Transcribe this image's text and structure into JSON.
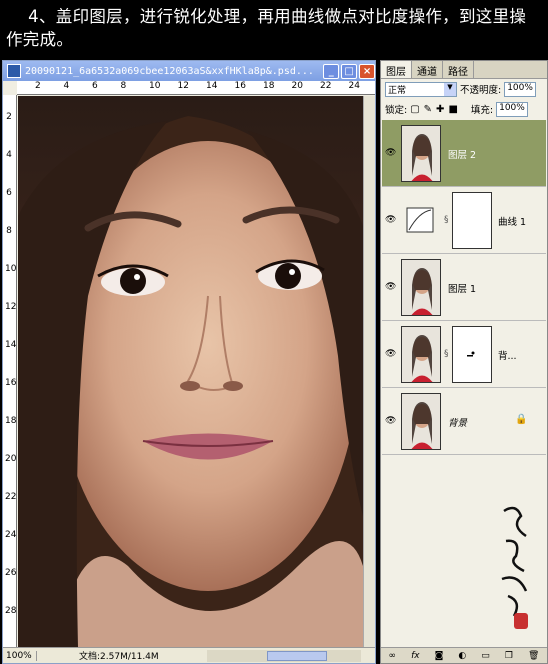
{
  "caption": {
    "line1": "    4、盖印图层，进行锐化处理，再用曲线做点对比度操作，到这里操",
    "line2": "作完成。"
  },
  "document": {
    "title": "20090121_6a6532a069cbee12063aS&xxfHKla8p&.psd...",
    "ruler_top_ticks": [
      "2",
      "4",
      "6",
      "8",
      "10",
      "12",
      "14",
      "16",
      "18",
      "20",
      "22",
      "24"
    ],
    "ruler_left_ticks": [
      "2",
      "4",
      "6",
      "8",
      "10",
      "12",
      "14",
      "16",
      "18",
      "20",
      "22",
      "24",
      "26",
      "28"
    ],
    "zoom": "100%",
    "doc_info": "文档:2.57M/11.4M",
    "min_icon": "minimize-icon",
    "max_icon": "maximize-icon",
    "close_icon": "close-icon"
  },
  "layers_panel": {
    "tabs": [
      "图层",
      "通道",
      "路径"
    ],
    "blend_mode": "正常",
    "opacity_label": "不透明度:",
    "opacity_value": "100%",
    "lock_label": "锁定:",
    "fill_label": "填充:",
    "fill_value": "100%",
    "layers": [
      {
        "name": "图层 2",
        "selected": true
      },
      {
        "name": "曲线 1",
        "selected": false
      },
      {
        "name": "图层 1",
        "selected": false
      },
      {
        "name": "背...",
        "selected": false
      },
      {
        "name": "背景",
        "selected": false
      }
    ],
    "bottom_icons": [
      "link-icon",
      "fx-icon",
      "mask-icon",
      "adjustment-icon",
      "folder-icon",
      "new-layer-icon",
      "trash-icon"
    ]
  },
  "colors": {
    "selected_layer": "#8f9c64",
    "title_bar": "#7d9fe3"
  }
}
